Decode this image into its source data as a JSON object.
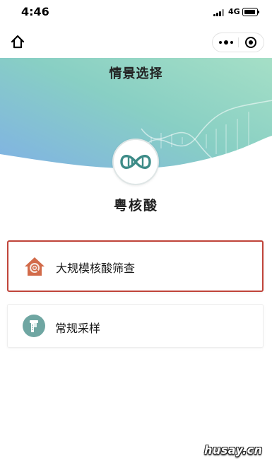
{
  "status_bar": {
    "time": "4:46",
    "network": "4G",
    "signal_icon": "signal-bars-icon",
    "battery_icon": "battery-icon"
  },
  "nav_bar": {
    "home_icon": "home-icon",
    "more_icon": "more-dots-icon",
    "close_icon": "target-close-icon"
  },
  "header": {
    "title": "情景选择",
    "gradient_colors": [
      "#7fb3ea",
      "#8fd6c2",
      "#a8e0c8"
    ]
  },
  "app": {
    "logo_icon": "dna-helix-logo-icon",
    "name": "粤核酸"
  },
  "options": [
    {
      "label": "大规模核酸筛查",
      "icon": "house-search-icon",
      "icon_color": "#d26b4a",
      "selected": true,
      "border_color": "#c0443a"
    },
    {
      "label": "常规采样",
      "icon": "sampling-swab-icon",
      "icon_color": "#6fa6a2",
      "selected": false
    }
  ],
  "watermark": "husay.cn"
}
